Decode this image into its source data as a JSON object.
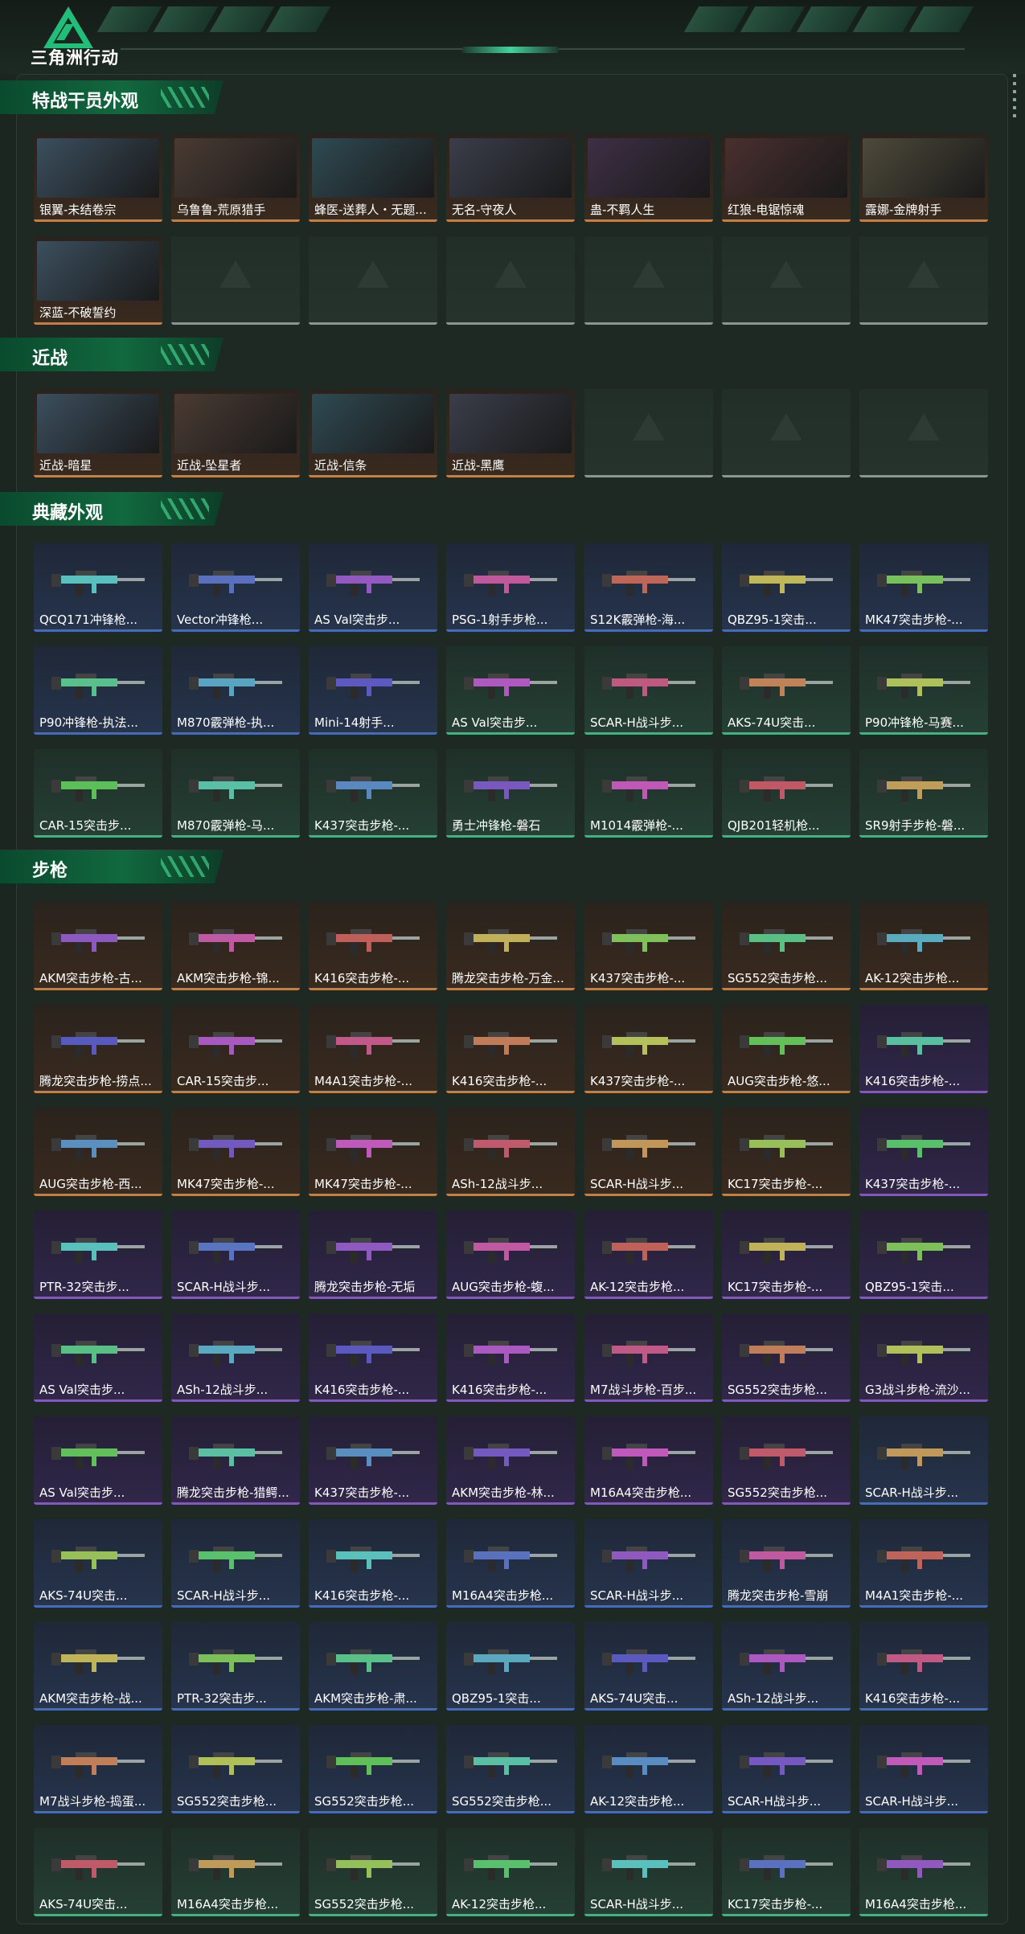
{
  "header": {
    "logo_text": "三角洲行动",
    "colors": {
      "accent": "#2bbf7f",
      "background": "#1b2620"
    }
  },
  "sections": [
    {
      "title": "特战干员外观",
      "rarity": "orange",
      "items": [
        "银翼-未结卷宗",
        "乌鲁鲁-荒原猎手",
        "蜂医-送葬人・无题...",
        "无名-守夜人",
        "蛊-不羁人生",
        "红狼-电锯惊魂",
        "露娜-金牌射手",
        "深蓝-不破誓约",
        "",
        "",
        "",
        "",
        "",
        ""
      ],
      "rarities": [
        "orange",
        "orange",
        "orange",
        "orange",
        "orange",
        "orange",
        "orange",
        "orange",
        "gray",
        "gray",
        "gray",
        "gray",
        "gray",
        "gray"
      ]
    },
    {
      "title": "近战",
      "rarity": "orange",
      "items": [
        "近战-暗星",
        "近战-坠星者",
        "近战-信条",
        "近战-黑鹰",
        "",
        "",
        ""
      ],
      "rarities": [
        "orange",
        "orange",
        "orange",
        "orange",
        "gray",
        "gray",
        "gray"
      ]
    },
    {
      "title": "典藏外观",
      "rarity": "blue",
      "items": [
        "QCQ171冲锋枪...",
        "Vector冲锋枪...",
        "AS Val突击步...",
        "PSG-1射手步枪...",
        "S12K霰弹枪-海...",
        "QBZ95-1突击...",
        "MK47突击步枪-...",
        "P90冲锋枪-执法...",
        "M870霰弹枪-执...",
        "Mini-14射手...",
        "AS Val突击步...",
        "SCAR-H战斗步...",
        "AKS-74U突击...",
        "P90冲锋枪-马赛...",
        "CAR-15突击步...",
        "M870霰弹枪-马...",
        "K437突击步枪-...",
        "勇士冲锋枪-磐石",
        "M1014霰弹枪-...",
        "QJB201轻机枪...",
        "SR9射手步枪-磐..."
      ],
      "rarities": [
        "blue",
        "blue",
        "blue",
        "blue",
        "blue",
        "blue",
        "blue",
        "blue",
        "blue",
        "blue",
        "green",
        "green",
        "green",
        "green",
        "green",
        "green",
        "green",
        "green",
        "green",
        "green",
        "green"
      ]
    },
    {
      "title": "步枪",
      "rarity": "orange",
      "items": [
        "AKM突击步枪-古...",
        "AKM突击步枪-锦...",
        "K416突击步枪-...",
        "腾龙突击步枪-万金...",
        "K437突击步枪-...",
        "SG552突击步枪...",
        "AK-12突击步枪...",
        "腾龙突击步枪-捞点...",
        "CAR-15突击步...",
        "M4A1突击步枪-...",
        "K416突击步枪-...",
        "K437突击步枪-...",
        "AUG突击步枪-悠...",
        "K416突击步枪-...",
        "AUG突击步枪-西...",
        "MK47突击步枪-...",
        "MK47突击步枪-...",
        "ASh-12战斗步...",
        "SCAR-H战斗步...",
        "KC17突击步枪-...",
        "K437突击步枪-...",
        "PTR-32突击步...",
        "SCAR-H战斗步...",
        "腾龙突击步枪-无垢",
        "AUG突击步枪-蝮...",
        "AK-12突击步枪...",
        "KC17突击步枪-...",
        "QBZ95-1突击...",
        "AS Val突击步...",
        "ASh-12战斗步...",
        "K416突击步枪-...",
        "K416突击步枪-...",
        "M7战斗步枪-百步...",
        "SG552突击步枪...",
        "G3战斗步枪-流沙...",
        "AS Val突击步...",
        "腾龙突击步枪-猎鳄...",
        "K437突击步枪-...",
        "AKM突击步枪-林...",
        "M16A4突击步枪...",
        "SG552突击步枪...",
        "SCAR-H战斗步...",
        "AKS-74U突击...",
        "SCAR-H战斗步...",
        "K416突击步枪-...",
        "M16A4突击步枪...",
        "SCAR-H战斗步...",
        "腾龙突击步枪-雪崩",
        "M4A1突击步枪-...",
        "AKM突击步枪-战...",
        "PTR-32突击步...",
        "AKM突击步枪-肃...",
        "QBZ95-1突击...",
        "AKS-74U突击...",
        "ASh-12战斗步...",
        "K416突击步枪-...",
        "M7战斗步枪-捣蛋...",
        "SG552突击步枪...",
        "SG552突击步枪...",
        "SG552突击步枪...",
        "AK-12突击步枪...",
        "SCAR-H战斗步...",
        "SCAR-H战斗步...",
        "AKS-74U突击...",
        "M16A4突击步枪...",
        "SG552突击步枪...",
        "AK-12突击步枪...",
        "SCAR-H战斗步...",
        "KC17突击步枪-...",
        "M16A4突击步枪..."
      ],
      "rarities": [
        "orange",
        "orange",
        "orange",
        "orange",
        "orange",
        "orange",
        "orange",
        "orange",
        "orange",
        "orange",
        "orange",
        "orange",
        "orange",
        "purple",
        "orange",
        "orange",
        "orange",
        "orange",
        "orange",
        "orange",
        "purple",
        "purple",
        "purple",
        "purple",
        "purple",
        "purple",
        "purple",
        "purple",
        "purple",
        "purple",
        "purple",
        "purple",
        "purple",
        "purple",
        "purple",
        "purple",
        "purple",
        "purple",
        "purple",
        "purple",
        "purple",
        "blue",
        "blue",
        "blue",
        "blue",
        "blue",
        "blue",
        "blue",
        "blue",
        "blue",
        "blue",
        "blue",
        "blue",
        "blue",
        "blue",
        "blue",
        "blue",
        "blue",
        "blue",
        "blue",
        "blue",
        "blue",
        "blue",
        "green",
        "green",
        "green",
        "green",
        "green",
        "green",
        "green"
      ]
    }
  ]
}
